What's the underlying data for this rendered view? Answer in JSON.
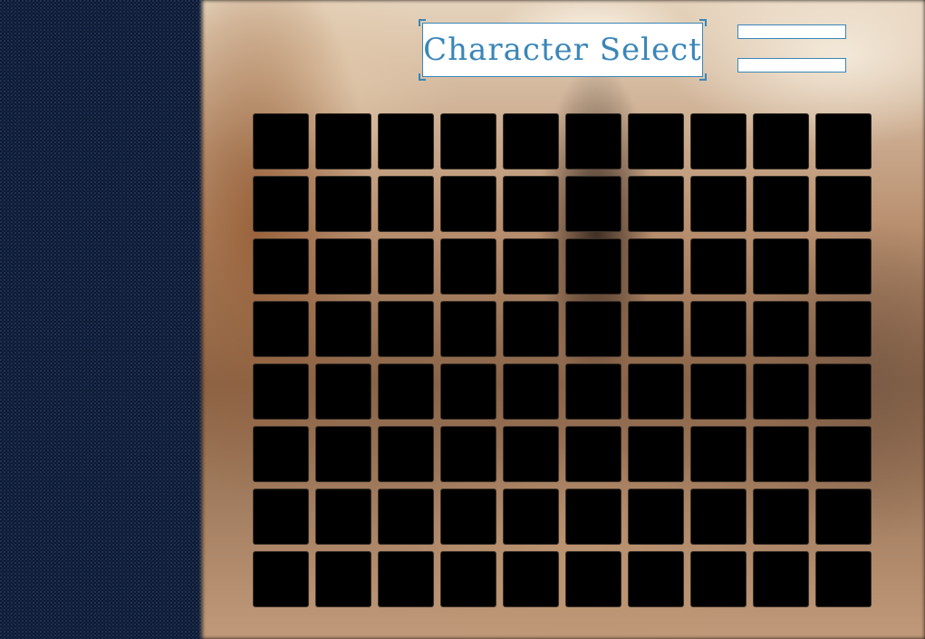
{
  "screen": {
    "title": "Character Select",
    "buttons": [
      {
        "label": ""
      },
      {
        "label": ""
      }
    ]
  },
  "grid": {
    "rows": 8,
    "columns": 10,
    "slots_filled": 0
  },
  "colors": {
    "accent": "#3a86b8",
    "panel": "#0f1a30",
    "slot": "#000000"
  }
}
